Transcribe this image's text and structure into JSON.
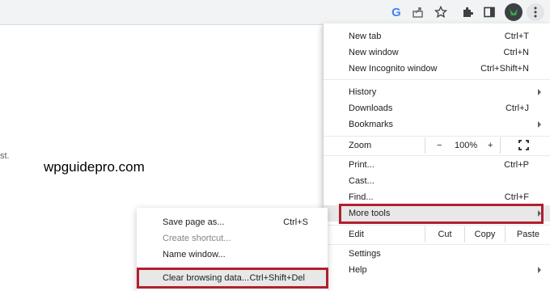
{
  "toolbar": {
    "icons": [
      "google-g-icon",
      "share-icon",
      "star-icon",
      "extensions-icon",
      "side-panel-icon",
      "profile-avatar",
      "kebab-menu-icon"
    ],
    "google_letter": "G"
  },
  "page": {
    "edge_text": "st.",
    "watermark": "wpguidepro.com"
  },
  "menu": {
    "new_tab": {
      "label": "New tab",
      "shortcut": "Ctrl+T"
    },
    "new_window": {
      "label": "New window",
      "shortcut": "Ctrl+N"
    },
    "new_incognito": {
      "label": "New Incognito window",
      "shortcut": "Ctrl+Shift+N"
    },
    "history": {
      "label": "History"
    },
    "downloads": {
      "label": "Downloads",
      "shortcut": "Ctrl+J"
    },
    "bookmarks": {
      "label": "Bookmarks"
    },
    "zoom": {
      "label": "Zoom",
      "minus": "−",
      "value": "100%",
      "plus": "+"
    },
    "print": {
      "label": "Print...",
      "shortcut": "Ctrl+P"
    },
    "cast": {
      "label": "Cast..."
    },
    "find": {
      "label": "Find...",
      "shortcut": "Ctrl+F"
    },
    "more_tools": {
      "label": "More tools"
    },
    "edit": {
      "label": "Edit",
      "cut": "Cut",
      "copy": "Copy",
      "paste": "Paste"
    },
    "settings": {
      "label": "Settings"
    },
    "help": {
      "label": "Help"
    }
  },
  "submenu": {
    "save_page": {
      "label": "Save page as...",
      "shortcut": "Ctrl+S"
    },
    "create_shortcut": {
      "label": "Create shortcut..."
    },
    "name_window": {
      "label": "Name window..."
    },
    "clear_browsing": {
      "label": "Clear browsing data...",
      "shortcut": "Ctrl+Shift+Del"
    }
  },
  "colors": {
    "highlight_frame": "#b0202e",
    "google_blue": "#4285f4"
  }
}
